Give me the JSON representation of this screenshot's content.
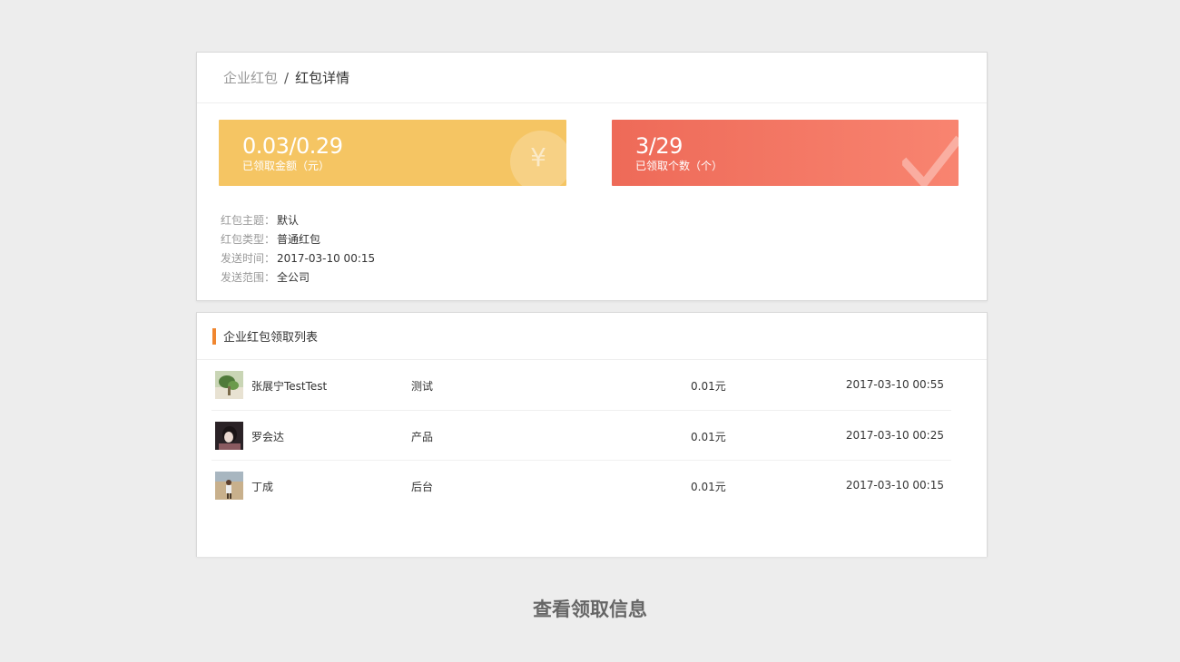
{
  "breadcrumb": {
    "root": "企业红包",
    "separator": "/",
    "current": "红包详情"
  },
  "stats": {
    "amount": {
      "value": "0.03/0.29",
      "label": "已领取金额（元）",
      "icon": "yuan-coin-icon",
      "glyph": "¥",
      "color": "#f5c563"
    },
    "count": {
      "value": "3/29",
      "label": "已领取个数（个）",
      "icon": "check-icon",
      "color": "#f07560"
    }
  },
  "info": [
    {
      "key": "红包主题：",
      "value": "默认"
    },
    {
      "key": "红包类型：",
      "value": "普通红包"
    },
    {
      "key": "发送时间：",
      "value": "2017-03-10 00:15"
    },
    {
      "key": "发送范围：",
      "value": "全公司"
    }
  ],
  "list": {
    "title": "企业红包领取列表",
    "accent": "#f0862f",
    "rows": [
      {
        "name": "张展宁TestTest",
        "dept": "测试",
        "amount": "0.01元",
        "time": "2017-03-10 00:55"
      },
      {
        "name": "罗会达",
        "dept": "产品",
        "amount": "0.01元",
        "time": "2017-03-10 00:25"
      },
      {
        "name": "丁成",
        "dept": "后台",
        "amount": "0.01元",
        "time": "2017-03-10 00:15"
      }
    ]
  },
  "caption": "查看领取信息"
}
